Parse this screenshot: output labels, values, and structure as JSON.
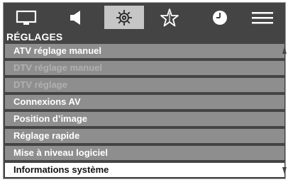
{
  "tabs": [
    {
      "icon": "picture-icon"
    },
    {
      "icon": "sound-icon"
    },
    {
      "icon": "settings-gear-icon",
      "selected": true
    },
    {
      "icon": "favorites-star-icon"
    },
    {
      "icon": "timer-clock-icon"
    },
    {
      "icon": "menu-lines-icon"
    }
  ],
  "menu": {
    "title": "RÉGLAGES",
    "items": [
      {
        "label": "ATV réglage manuel",
        "enabled": true
      },
      {
        "label": "DTV réglage manuel",
        "enabled": false
      },
      {
        "label": "DTV réglage",
        "enabled": false
      },
      {
        "label": "Connexions AV",
        "enabled": true
      },
      {
        "label": "Position d’image",
        "enabled": true
      },
      {
        "label": "Réglage rapide",
        "enabled": true
      },
      {
        "label": "Mise à niveau logiciel",
        "enabled": true
      },
      {
        "label": "Informations système",
        "enabled": true,
        "selected": true
      }
    ]
  },
  "colors": {
    "panel_background": "#444444",
    "item_background": "#8e8e8e",
    "selected_item_background": "#ffffff",
    "selected_tab_background": "#c6c6c6",
    "disabled_text": "#b0b0b0"
  }
}
